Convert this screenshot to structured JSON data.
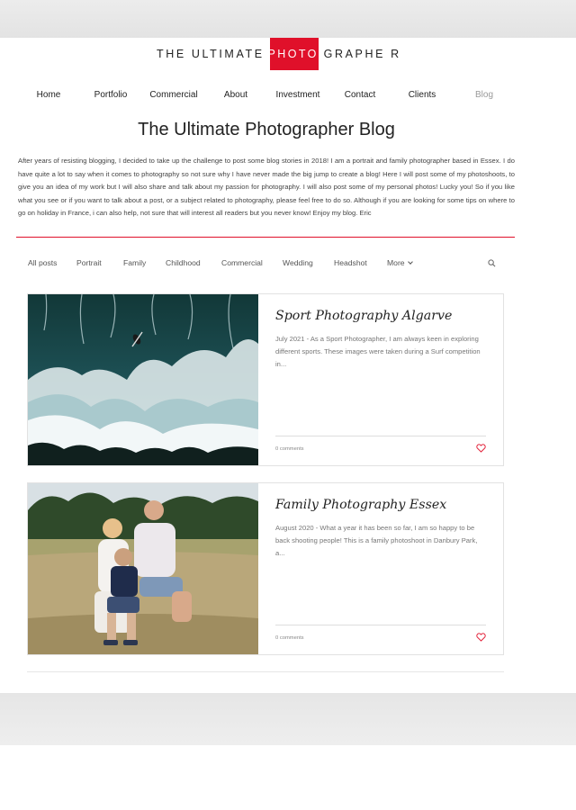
{
  "logo": {
    "left": "THE ULTIMATE",
    "middle": "PHOTO",
    "right": "GRAPHE R"
  },
  "nav": {
    "items": [
      "Home",
      "Portfolio",
      "Commercial",
      "About",
      "Investment",
      "Contact",
      "Clients",
      "Blog"
    ],
    "active": "Blog"
  },
  "blog_title": "The Ultimate Photographer Blog",
  "intro": "After years of resisting blogging, I decided to take up the challenge to post some blog stories in 2018! I am a portrait and family photographer based in Essex. I do have quite a lot to say when it comes to photography so not sure why I have never made the big jump to create a blog! Here I will post some of my photoshoots, to give you an idea of my work but I will also share and talk about my passion for photography. I will also post some of my personal photos! Lucky you! So if you like what you see or if you want to talk about a post, or a subject related to photography, please feel free to do so. Although if you are looking for some tips on where to go on holiday in France, i can also help, not sure that will interest all readers but you never know! Enjoy my blog. Eric",
  "categories": [
    "All posts",
    "Portrait",
    "Family",
    "Childhood",
    "Commercial",
    "Wedding",
    "Headshot",
    "More"
  ],
  "posts": [
    {
      "title": "Sport Photography Algarve",
      "excerpt": "July 2021 - As a Sport Photographer, I am always keen in exploring different sports. These images were taken during a Surf competition in...",
      "comments": "0 comments",
      "image": "aerial surf ocean"
    },
    {
      "title": "Family Photography Essex",
      "excerpt": "August 2020 - What a year it has been so far, I am so happy to be back shooting people! This is a family photoshoot in Danbury Park, a...",
      "comments": "0 comments",
      "image": "family portrait in park"
    }
  ],
  "colors": {
    "accent": "#e0102a",
    "heart": "#e0102a",
    "text": "#222222",
    "muted": "#777777"
  },
  "icons": {
    "search": "search-icon",
    "heart": "heart-icon",
    "chevron": "chevron-down-icon"
  }
}
